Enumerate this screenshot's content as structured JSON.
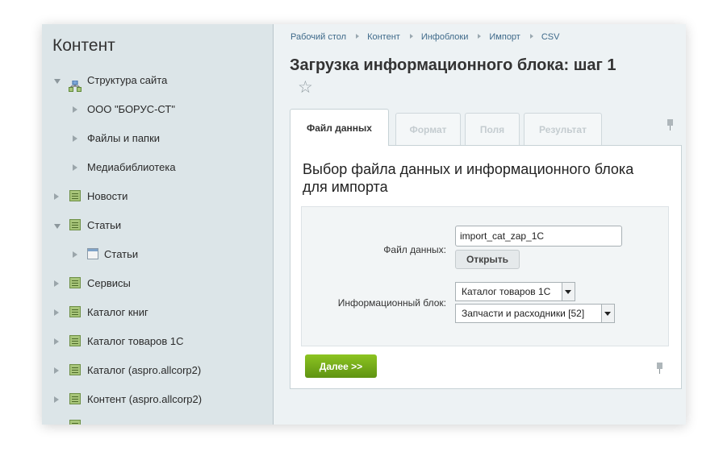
{
  "sidebar": {
    "title": "Контент",
    "items": [
      {
        "label": "Структура сайта",
        "icon": "site-structure-icon"
      },
      {
        "label": "ООО \"БОРУС-СТ\""
      },
      {
        "label": "Файлы и папки"
      },
      {
        "label": "Медиабиблиотека"
      },
      {
        "label": "Новости",
        "icon": "infoblock-icon"
      },
      {
        "label": "Статьи",
        "icon": "infoblock-icon"
      },
      {
        "label": "Статьи",
        "icon": "list-icon"
      },
      {
        "label": "Сервисы",
        "icon": "infoblock-icon"
      },
      {
        "label": "Каталог книг",
        "icon": "infoblock-icon"
      },
      {
        "label": "Каталог товаров 1С",
        "icon": "infoblock-icon"
      },
      {
        "label": "Каталог (aspro.allcorp2)",
        "icon": "infoblock-icon"
      },
      {
        "label": "Контент (aspro.allcorp2)",
        "icon": "infoblock-icon"
      }
    ]
  },
  "breadcrumbs": [
    "Рабочий стол",
    "Контент",
    "Инфоблоки",
    "Импорт",
    "CSV"
  ],
  "page_title": "Загрузка информационного блока: шаг 1",
  "tabs": [
    {
      "label": "Файл данных",
      "state": "active"
    },
    {
      "label": "Формат",
      "state": "disabled"
    },
    {
      "label": "Поля",
      "state": "disabled"
    },
    {
      "label": "Результат",
      "state": "disabled"
    }
  ],
  "panel": {
    "heading": "Выбор файла данных и информационного блока для импорта",
    "data_file_label": "Файл данных:",
    "data_file_value": "import_cat_zap_1C",
    "open_button": "Открыть",
    "infoblock_label": "Информационный блок:",
    "infoblock_type_value": "Каталог товаров 1С",
    "infoblock_value": "Запчасти и расходники [52]",
    "next_button": "Далее >>"
  },
  "colors": {
    "accent_green": "#6aa51a",
    "link_blue": "#3f6a8a",
    "sidebar_bg": "#dce5e8"
  }
}
